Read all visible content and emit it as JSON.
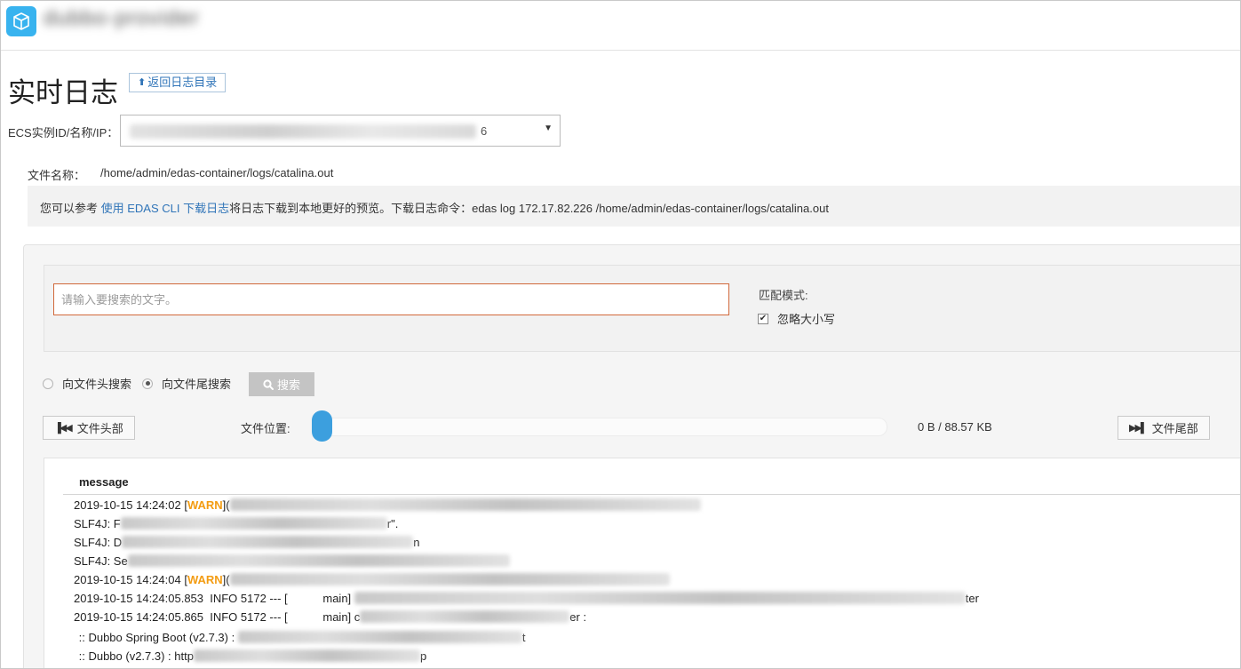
{
  "header": {
    "app_title": "dubbo-provider"
  },
  "page": {
    "title": "实时日志",
    "back_label": "返回日志目录"
  },
  "ecs": {
    "label": "ECS实例ID/名称/IP：",
    "selected_tail": "6"
  },
  "file": {
    "label": "文件名称：",
    "path": "/home/admin/edas-container/logs/catalina.out"
  },
  "notice": {
    "prefix": "您可以参考 ",
    "link": "使用 EDAS CLI 下载日志",
    "suffix": "将日志下载到本地更好的预览。下载日志命令：edas log 172.17.82.226 /home/admin/edas-container/logs/catalina.out"
  },
  "search": {
    "placeholder": "请输入要搜索的文字。",
    "match_mode_label": "匹配模式:",
    "ignore_case_label": "忽略大小写",
    "ignore_case_checked": true,
    "radio_head_label": "向文件头搜索",
    "radio_tail_label": "向文件尾搜索",
    "selected_direction": "tail",
    "button_label": "搜索"
  },
  "navigation": {
    "head_button": "文件头部",
    "position_label": "文件位置:",
    "position_fraction": 0,
    "size_text": "0 B / 88.57 KB",
    "tail_button": "文件尾部"
  },
  "log": {
    "column_header": "message",
    "lines": [
      {
        "before": "2019-10-15 14:24:02 [",
        "level": "WARN",
        "after": " ](",
        "tail": ""
      },
      {
        "before": "SLF4J: F",
        "level": "",
        "after": "",
        "tail": "r\"."
      },
      {
        "before": "SLF4J: D",
        "level": "",
        "after": "",
        "tail": "n"
      },
      {
        "before": "SLF4J: Se",
        "level": "",
        "after": "",
        "tail": ""
      },
      {
        "before": "2019-10-15 14:24:04 [",
        "level": "WARN",
        "after": " ](",
        "tail": ""
      },
      {
        "before": "2019-10-15 14:24:05.853  INFO 5172 --- [           main] ",
        "level": "",
        "after": "",
        "tail": "ter"
      },
      {
        "before": "2019-10-15 14:24:05.865  INFO 5172 --- [           main] c",
        "level": "",
        "after": "",
        "tail": "er :"
      },
      {
        "before": " :: Dubbo Spring Boot (v2.7.3) : ",
        "level": "",
        "after": "",
        "tail": "t"
      },
      {
        "before": " :: Dubbo (v2.7.3) : http",
        "level": "",
        "after": "",
        "tail": "p"
      }
    ]
  },
  "colors": {
    "accent": "#2f74b8",
    "warn": "#f39c12",
    "input_border": "#d1683a",
    "slider": "#3c9fde"
  }
}
